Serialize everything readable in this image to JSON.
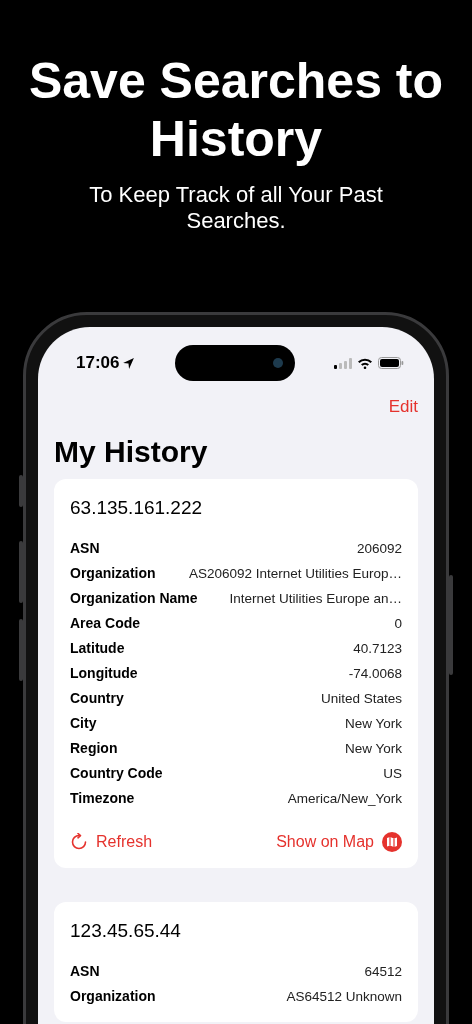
{
  "headline": "Save Searches to History",
  "subtitle": "To Keep Track of all Your Past Searches.",
  "status_bar": {
    "time": "17:06"
  },
  "nav": {
    "edit": "Edit"
  },
  "title": "My History",
  "cards": [
    {
      "ip": "63.135.161.222",
      "fields": [
        {
          "label": "ASN",
          "value": "206092"
        },
        {
          "label": "Organization",
          "value": "AS206092 Internet Utilities Europ…"
        },
        {
          "label": "Organization Name",
          "value": "Internet Utilities Europe an…"
        },
        {
          "label": "Area Code",
          "value": "0"
        },
        {
          "label": "Latitude",
          "value": "40.7123"
        },
        {
          "label": "Longitude",
          "value": "-74.0068"
        },
        {
          "label": "Country",
          "value": "United States"
        },
        {
          "label": "City",
          "value": "New York"
        },
        {
          "label": "Region",
          "value": "New York"
        },
        {
          "label": "Country Code",
          "value": "US"
        },
        {
          "label": "Timezone",
          "value": "America/New_York"
        }
      ],
      "actions": {
        "refresh": "Refresh",
        "map": "Show on Map"
      }
    },
    {
      "ip": "123.45.65.44",
      "fields": [
        {
          "label": "ASN",
          "value": "64512"
        },
        {
          "label": "Organization",
          "value": "AS64512 Unknown"
        }
      ]
    }
  ]
}
